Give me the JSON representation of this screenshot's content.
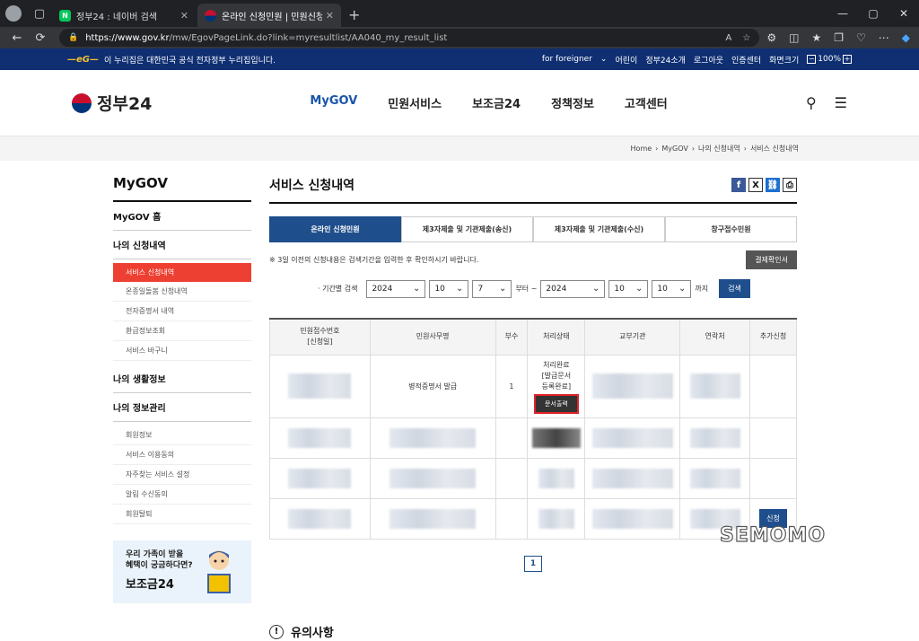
{
  "browser": {
    "tabs": [
      {
        "title": "정부24 : 네이버 검색",
        "favicon": "N"
      },
      {
        "title": "온라인 신청민원 | 민원신청 내역 조회",
        "favicon": ""
      }
    ],
    "url_host": "https://www.gov.kr",
    "url_path": "/mw/EgovPageLink.do?link=myresultlist/AA040_my_result_list"
  },
  "gov_strip": {
    "official_text": "이 누리집은 대한민국 공식 전자정부 누리집입니다.",
    "links": [
      "for foreigner",
      "어린이",
      "정부24소개",
      "로그아웃",
      "인증센터",
      "화면크기"
    ],
    "zoom": "100%"
  },
  "header": {
    "logo_text": "정부24",
    "nav": [
      "MyGOV",
      "민원서비스",
      "보조금24",
      "정책정보",
      "고객센터"
    ]
  },
  "breadcrumb": [
    "Home",
    "MyGOV",
    "나의 신청내역",
    "서비스 신청내역"
  ],
  "lnb": {
    "title": "MyGOV",
    "home": "MyGOV 홈",
    "groups": [
      {
        "label": "나의 신청내역",
        "items": [
          "서비스 신청내역",
          "온종일돌봄 신청내역",
          "전자증명서 내역",
          "환급정보조회",
          "서비스 바구니"
        ]
      },
      {
        "label": "나의 생활정보",
        "items": []
      },
      {
        "label": "나의 정보관리",
        "items": [
          "회원정보",
          "서비스 이용동의",
          "자주찾는 서비스 설정",
          "알림 수신동의",
          "회원탈퇴"
        ]
      }
    ],
    "promo_line1": "우리 가족이 받을",
    "promo_line2": "혜택이 궁금하다면?",
    "promo_title": "보조금24"
  },
  "main": {
    "title": "서비스 신청내역",
    "tabs": [
      "온라인 신청민원",
      "제3자제출 및 기관제출(송신)",
      "제3자제출 및 기관제출(수신)",
      "창구접수민원"
    ],
    "notice": "※ 3일 이전의 신청내용은 검색기간을 입력한 후 확인하시기 바랍니다.",
    "payment_button": "결제확인서",
    "search": {
      "label": "· 기간별 검색",
      "from_year": "2024",
      "from_month": "10",
      "from_day": "7",
      "from_suffix": "부터 ~",
      "to_year": "2024",
      "to_month": "10",
      "to_day": "10",
      "to_suffix": "까지",
      "button": "검색"
    },
    "table": {
      "headers": [
        "민원접수번호\n[신청일]",
        "민원사무명",
        "부수",
        "처리상태",
        "교부기관",
        "연락처",
        "추가신청"
      ],
      "row1": {
        "name": "병적증명서 발급",
        "copies": "1",
        "status": "처리완료\n[발급문서\n등록완료]",
        "print_button": "문서출력"
      },
      "apply_button": "신청"
    },
    "page": "1",
    "caution_title": "유의사항"
  },
  "watermark": "SEMOMO"
}
